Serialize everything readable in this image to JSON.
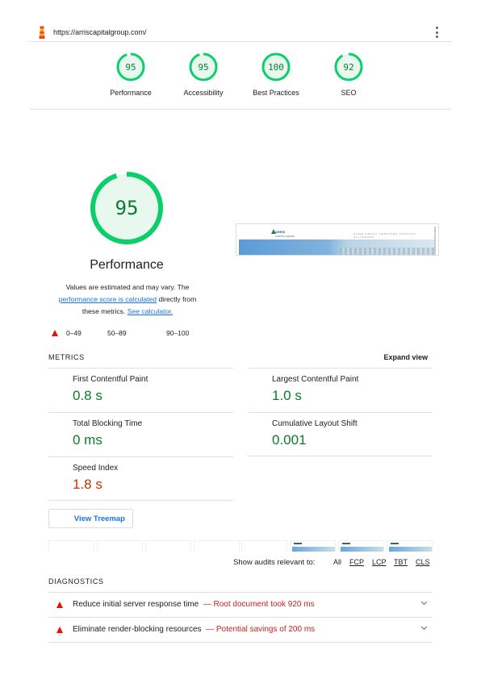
{
  "header": {
    "url": "https://arriscapitalgroup.com/",
    "logo_icon": "lighthouse-icon",
    "menu_icon": "kebab-menu-icon"
  },
  "categories": [
    {
      "label": "Performance",
      "score": "95"
    },
    {
      "label": "Accessibility",
      "score": "95"
    },
    {
      "label": "Best Practices",
      "score": "100"
    },
    {
      "label": "SEO",
      "score": "92"
    }
  ],
  "performance": {
    "score": "95",
    "title": "Performance",
    "desc_1": "Values are estimated and may vary. The",
    "desc_link_1": "performance score is calculated",
    "desc_2": "directly from",
    "desc_3": "these metrics.",
    "desc_link_2": "See calculator."
  },
  "screenshot": {
    "logo_text": "ARRIS",
    "logo_sub": "CAPITAL GROUP",
    "nav_text": "HOME  ABOUT  SERVICES  CONTACT  ALLIANCES"
  },
  "legend": {
    "fail": "0–49",
    "average": "50–89",
    "pass": "90–100"
  },
  "metrics_section": {
    "title": "METRICS",
    "expand_label": "Expand view"
  },
  "metrics": [
    {
      "label": "First Contentful Paint",
      "value": "0.8 s",
      "status": "pass"
    },
    {
      "label": "Largest Contentful Paint",
      "value": "1.0 s",
      "status": "pass"
    },
    {
      "label": "Total Blocking Time",
      "value": "0 ms",
      "status": "pass"
    },
    {
      "label": "Cumulative Layout Shift",
      "value": "0.001",
      "status": "pass"
    },
    {
      "label": "Speed Index",
      "value": "1.8 s",
      "status": "average"
    }
  ],
  "treemap_button": "View Treemap",
  "audit_filter": {
    "label": "Show audits relevant to:",
    "options": [
      "All",
      "FCP",
      "LCP",
      "TBT",
      "CLS"
    ]
  },
  "diagnostics": {
    "title": "DIAGNOSTICS",
    "items": [
      {
        "title": "Reduce initial server response time",
        "detail": "— Root document took 920 ms"
      },
      {
        "title": "Eliminate render-blocking resources",
        "detail": "— Potential savings of 200 ms"
      }
    ]
  },
  "colors": {
    "pass": "#0cce6b",
    "average": "#ffa400",
    "fail": "#eb0f00",
    "link": "#1a73e8"
  }
}
